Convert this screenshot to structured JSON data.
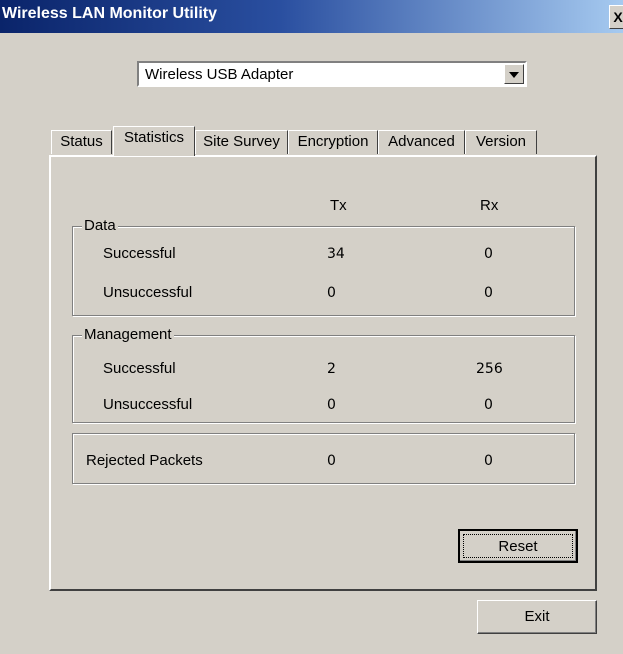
{
  "window": {
    "title": "Wireless LAN Monitor Utility",
    "close_glyph": "X"
  },
  "adapter": {
    "selected": "Wireless USB Adapter"
  },
  "tabs": [
    {
      "label": "Status"
    },
    {
      "label": "Statistics"
    },
    {
      "label": "Site Survey"
    },
    {
      "label": "Encryption"
    },
    {
      "label": "Advanced"
    },
    {
      "label": "Version"
    }
  ],
  "active_tab": "Statistics",
  "columns": {
    "tx": "Tx",
    "rx": "Rx"
  },
  "data_group": {
    "title": "Data",
    "rows": [
      {
        "label": "Successful",
        "tx": "34",
        "rx": "0"
      },
      {
        "label": "Unsuccessful",
        "tx": "0",
        "rx": "0"
      }
    ]
  },
  "management_group": {
    "title": "Management",
    "rows": [
      {
        "label": "Successful",
        "tx": "2",
        "rx": "256"
      },
      {
        "label": "Unsuccessful",
        "tx": "0",
        "rx": "0"
      }
    ]
  },
  "rejected": {
    "label": "Rejected Packets",
    "tx": "0",
    "rx": "0"
  },
  "buttons": {
    "reset": "Reset",
    "exit": "Exit"
  }
}
